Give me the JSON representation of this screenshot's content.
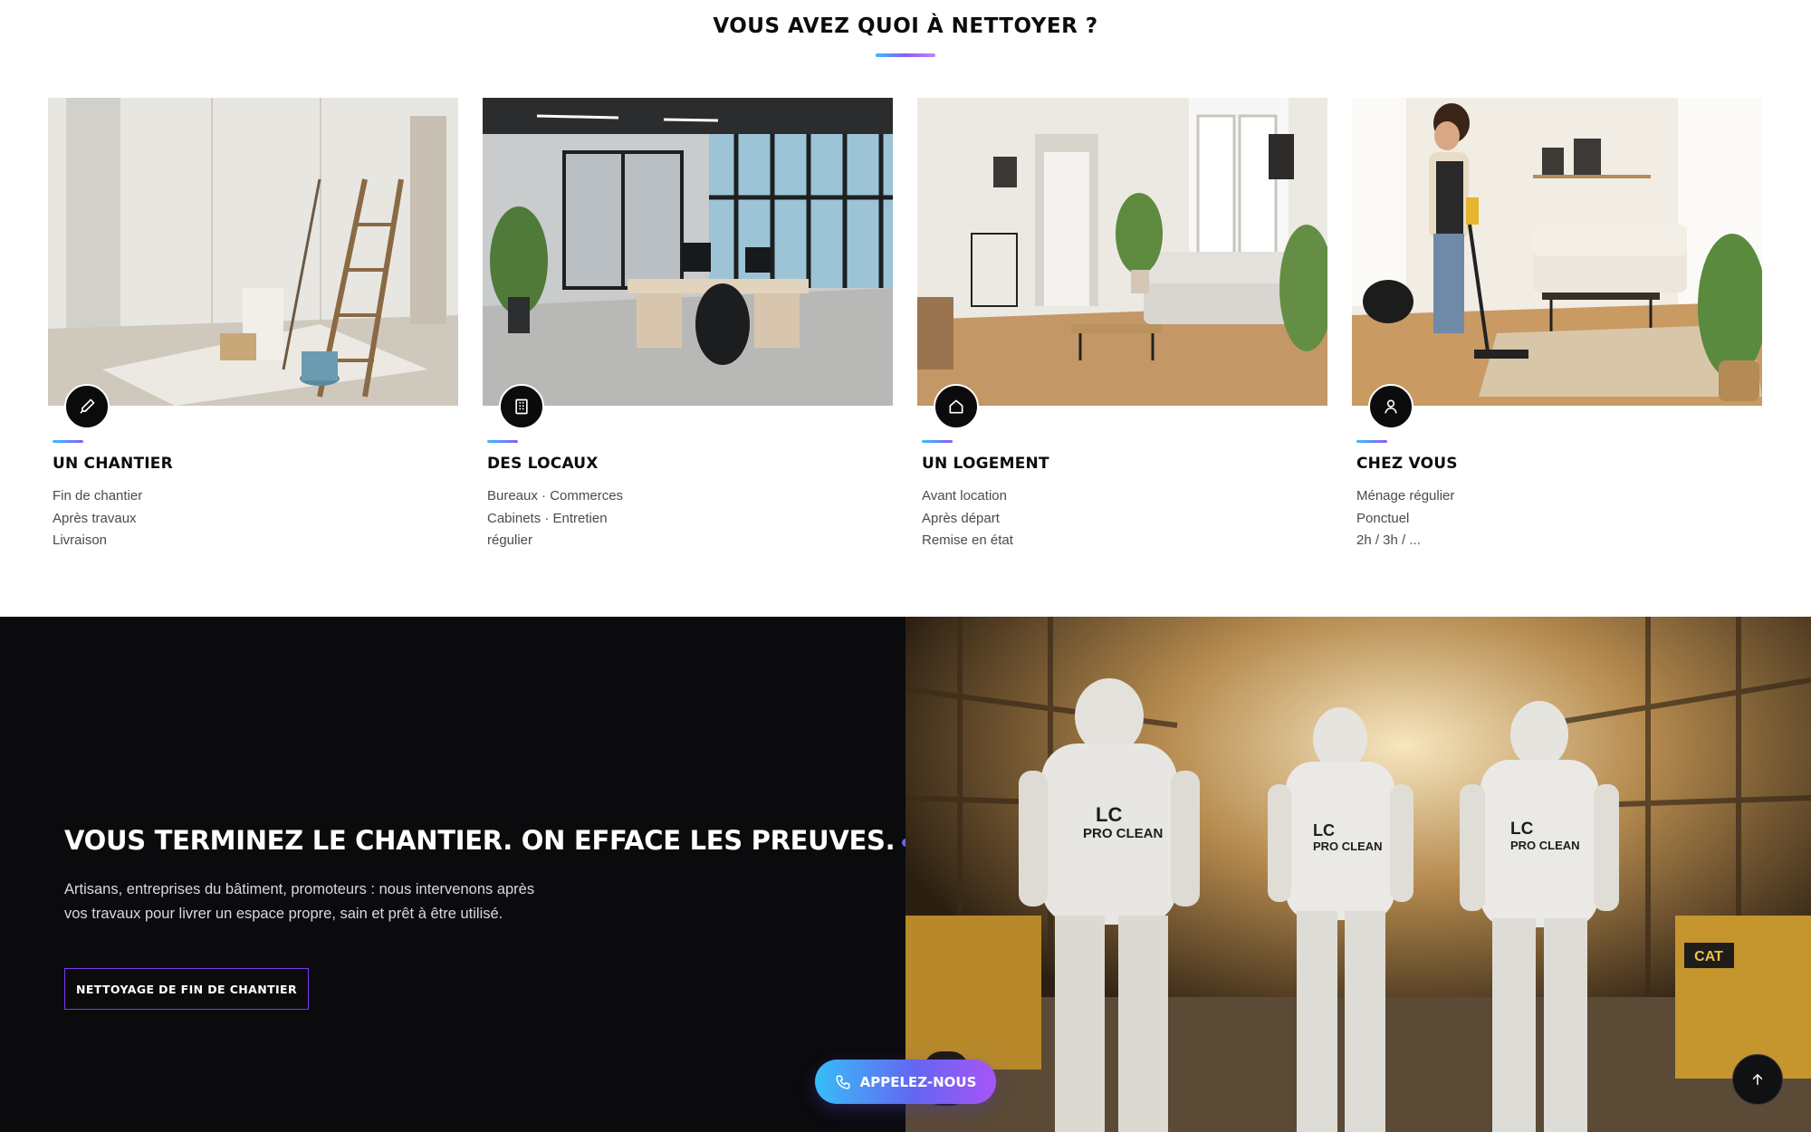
{
  "services": {
    "title": "VOUS AVEZ QUOI À NETTOYER ?",
    "cards": [
      {
        "title": "UN CHANTIER",
        "lines": [
          "Fin de chantier",
          "Après travaux",
          "Livraison"
        ],
        "icon": "brush-icon",
        "photo": "construction-room-photo"
      },
      {
        "title": "DES LOCAUX",
        "lines": [
          "Bureaux · Commerces",
          "Cabinets · Entretien",
          "régulier"
        ],
        "icon": "building-icon",
        "photo": "office-photo"
      },
      {
        "title": "UN LOGEMENT",
        "lines": [
          "Avant location",
          "Après départ",
          "Remise en état"
        ],
        "icon": "home-icon",
        "photo": "living-room-photo"
      },
      {
        "title": "CHEZ VOUS",
        "lines": [
          "Ménage régulier",
          "Ponctuel",
          "2h / 3h / ..."
        ],
        "icon": "user-icon",
        "photo": "cleaning-woman-photo"
      }
    ]
  },
  "hero": {
    "title": "VOUS TERMINEZ LE CHANTIER. ON EFFACE LES PREUVES.",
    "text": "Artisans, entreprises du bâtiment, promoteurs : nous intervenons après vos travaux pour livrer un espace propre, sain et prêt à être utilisé.",
    "button": "NETTOYAGE DE FIN DE CHANTIER",
    "photo_labels": [
      {
        "line1": "LC",
        "line2": "PRO CLEAN"
      },
      {
        "line1": "LC",
        "line2": "PRO CLEAN"
      },
      {
        "line1": "LC",
        "line2": "PRO CLEAN"
      }
    ],
    "machine_brand": "CAT"
  },
  "floating": {
    "call": "APPELEZ-NOUS"
  },
  "colors": {
    "accent_start": "#38bdf8",
    "accent_mid": "#8b5cf6",
    "dark_bg": "#0b0b0e"
  }
}
